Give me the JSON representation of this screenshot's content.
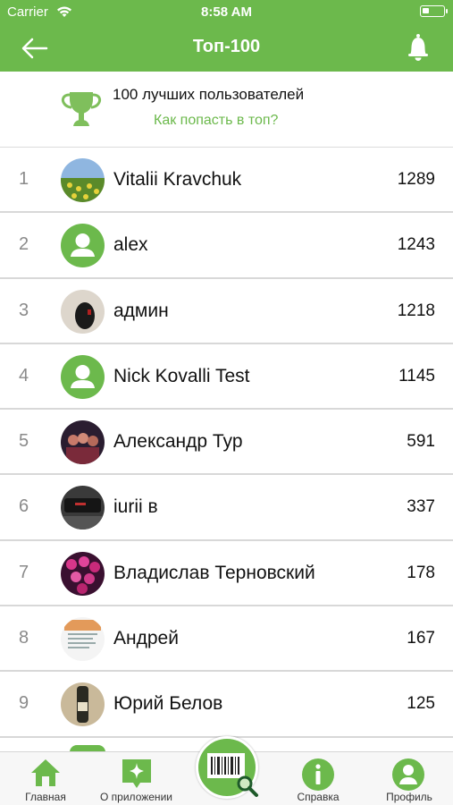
{
  "status_bar": {
    "carrier": "Carrier",
    "time": "8:58 AM"
  },
  "nav": {
    "title": "Топ-100"
  },
  "intro": {
    "heading": "100 лучших пользователей",
    "link": "Как попасть в топ?"
  },
  "accent_color": "#6cb94c",
  "leaderboard": [
    {
      "rank": "1",
      "name": "Vitalii Kravchuk",
      "score": "1289",
      "avatar": "photo-field"
    },
    {
      "rank": "2",
      "name": "alex",
      "score": "1243",
      "avatar": "default-user-icon"
    },
    {
      "rank": "3",
      "name": "админ",
      "score": "1218",
      "avatar": "photo-mouse"
    },
    {
      "rank": "4",
      "name": "Nick Kovalli Test",
      "score": "1145",
      "avatar": "default-user-icon"
    },
    {
      "rank": "5",
      "name": "Александр Тур",
      "score": "591",
      "avatar": "photo-group"
    },
    {
      "rank": "6",
      "name": "iurii в",
      "score": "337",
      "avatar": "photo-device"
    },
    {
      "rank": "7",
      "name": "Владислав Терновский",
      "score": "178",
      "avatar": "photo-flowers"
    },
    {
      "rank": "8",
      "name": "Андрей",
      "score": "167",
      "avatar": "photo-document"
    },
    {
      "rank": "9",
      "name": "Юрий Белов",
      "score": "125",
      "avatar": "photo-bottle"
    }
  ],
  "tabs": [
    {
      "label": "Главная",
      "icon": "home-icon"
    },
    {
      "label": "О приложении",
      "icon": "sparkle-icon"
    },
    {
      "label": "",
      "icon": "barcode-scan-icon"
    },
    {
      "label": "Справка",
      "icon": "info-icon"
    },
    {
      "label": "Профиль",
      "icon": "profile-icon"
    }
  ]
}
